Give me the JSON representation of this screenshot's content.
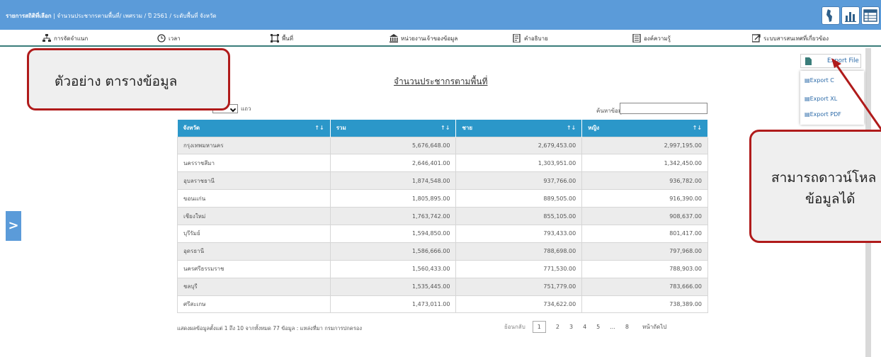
{
  "topbar": {
    "title_bold": "รายการสถิติที่เลือก",
    "title_rest": " | จำนวนประชากรตามพื้นที่/ เพศรวม / ปี 2561 / ระดับพื้นที่ จังหวัด"
  },
  "menu": [
    {
      "label": "การจัดจำแนก",
      "icon": "hierarchy-icon"
    },
    {
      "label": "เวลา",
      "icon": "clock-icon"
    },
    {
      "label": "พื้นที่",
      "icon": "area-icon"
    },
    {
      "label": "หน่วยงานเจ้าของข้อมูล",
      "icon": "building-icon"
    },
    {
      "label": "คำอธิบาย",
      "icon": "document-icon"
    },
    {
      "label": "องค์ความรู้",
      "icon": "book-icon"
    },
    {
      "label": "ระบบสารสนเทศที่เกี่ยวข้อง",
      "icon": "link-icon"
    }
  ],
  "report_title": "จำนวนประชากรตามพื้นที่",
  "entries": {
    "suffix": "แถว"
  },
  "search": {
    "label": "ค้นหาข้อมูล"
  },
  "table": {
    "headers": [
      "จังหวัด",
      "รวม",
      "ชาย",
      "หญิง"
    ],
    "rows": [
      [
        "กรุงเทพมหานคร",
        "5,676,648.00",
        "2,679,453.00",
        "2,997,195.00"
      ],
      [
        "นครราชสีมา",
        "2,646,401.00",
        "1,303,951.00",
        "1,342,450.00"
      ],
      [
        "อุบลราชธานี",
        "1,874,548.00",
        "937,766.00",
        "936,782.00"
      ],
      [
        "ขอนแก่น",
        "1,805,895.00",
        "889,505.00",
        "916,390.00"
      ],
      [
        "เชียงใหม่",
        "1,763,742.00",
        "855,105.00",
        "908,637.00"
      ],
      [
        "บุรีรัมย์",
        "1,594,850.00",
        "793,433.00",
        "801,417.00"
      ],
      [
        "อุดรธานี",
        "1,586,666.00",
        "788,698.00",
        "797,968.00"
      ],
      [
        "นครศรีธรรมราช",
        "1,560,433.00",
        "771,530.00",
        "788,903.00"
      ],
      [
        "ชลบุรี",
        "1,535,445.00",
        "751,779.00",
        "783,666.00"
      ],
      [
        "ศรีสะเกษ",
        "1,473,011.00",
        "734,622.00",
        "738,389.00"
      ]
    ]
  },
  "footer": {
    "info": "แสดงผลข้อมูลตั้งแต่ 1 ถึง 10 จากทั้งหมด 77 ข้อมูล : แหล่งที่มา กรมการปกครอง",
    "prev": "ย้อนกลับ",
    "pages": [
      "1",
      "2",
      "3",
      "4",
      "5",
      "...",
      "8"
    ],
    "next": "หน้าถัดไป"
  },
  "export": {
    "button": "Export File",
    "options": [
      "Export C",
      "Export XL",
      "Export PDF"
    ]
  },
  "callouts": {
    "left": "ตัวอย่าง ตารางข้อมูล",
    "right_line1": "สามารถดาวน์โหล",
    "right_line2": "ข้อมูลได้"
  },
  "side_arrow": ">",
  "colors": {
    "topbar": "#5b9bd9",
    "table_header": "#2b97c9",
    "callout_border": "#b01b1b"
  }
}
